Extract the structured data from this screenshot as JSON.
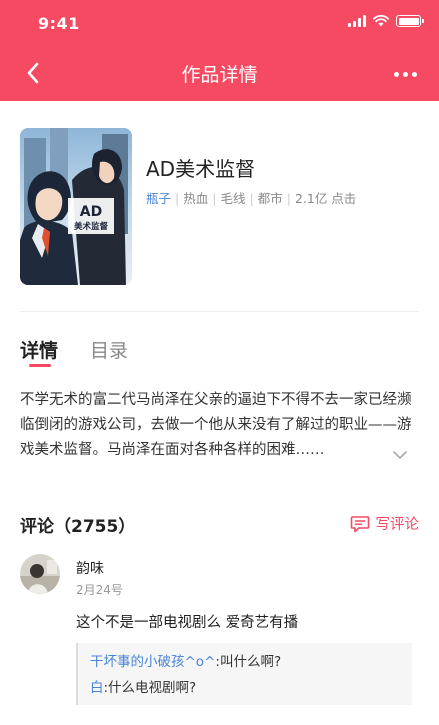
{
  "status_bar": {
    "time": "9:41"
  },
  "nav": {
    "title": "作品详情"
  },
  "book": {
    "cover_logo": "AD",
    "cover_subtitle": "美术监督",
    "title": "AD美术监督",
    "author": "瓶子",
    "tags": [
      "热血",
      "毛线",
      "都市"
    ],
    "clicks": "2.1亿 点击"
  },
  "tabs": [
    {
      "label": "详情",
      "active": true
    },
    {
      "label": "目录",
      "active": false
    }
  ],
  "synopsis": "不学无术的富二代马尚泽在父亲的逼迫下不得不去一家已经濒临倒闭的游戏公司，去做一个他从来没有了解过的职业——游戏美术监督。马尚泽在面对各种各样的困难……",
  "comments": {
    "title": "评论（2755）",
    "write_label": "写评论",
    "items": [
      {
        "name": "韵味",
        "date": "2月24号",
        "text": "这个不是一部电视剧么 爱奇艺有播",
        "replies": [
          {
            "user": "干坏事的小破孩^o^",
            "text": ":叫什么啊?"
          },
          {
            "user": "白",
            "text": ":什么电视剧啊?"
          }
        ]
      }
    ]
  },
  "colors": {
    "accent": "#f64a63",
    "link": "#4a84d8"
  }
}
